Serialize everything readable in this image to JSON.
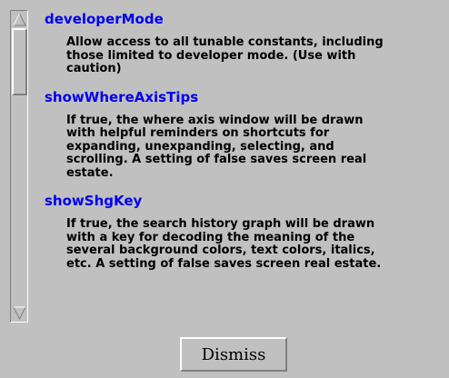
{
  "colors": {
    "background": "#c0c0c0",
    "title": "#0000ee",
    "text": "#000000"
  },
  "scrollbar": {
    "up_icon": "triangle-up-icon",
    "down_icon": "triangle-down-icon",
    "position": 0.1
  },
  "help_items": [
    {
      "title": "developerMode",
      "description": "Allow access to all tunable constants, including those limited to developer mode. (Use with caution)"
    },
    {
      "title": "showWhereAxisTips",
      "description": "If true, the where axis window will be drawn with helpful reminders on shortcuts for expanding, unexpanding, selecting, and scrolling.  A setting of false saves screen real estate."
    },
    {
      "title": "showShgKey",
      "description": "If true, the search history graph will be drawn with a key for decoding the meaning of the several background colors, text colors, italics, etc.  A setting of false saves screen real estate."
    }
  ],
  "dismiss_label": "Dismiss"
}
